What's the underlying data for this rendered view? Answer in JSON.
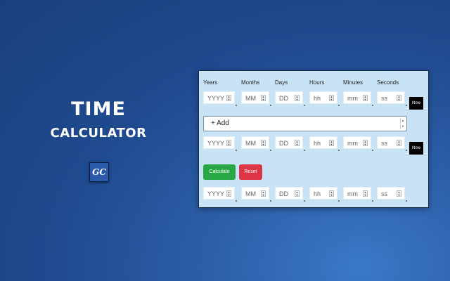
{
  "hero": {
    "title": "TIME",
    "subtitle": "CALCULATOR",
    "logo_text": "GC"
  },
  "form": {
    "headers": [
      "Years",
      "Months",
      "Days",
      "Hours",
      "Minutes",
      "Seconds"
    ],
    "placeholders": [
      "YYYY",
      "MM",
      "DD",
      "hh",
      "mm",
      "ss"
    ],
    "now_label": "Now",
    "operation_selected": "+ Add",
    "calculate_label": "Calculate",
    "reset_label": "Reset"
  },
  "colors": {
    "panel_bg": "#c9e3f6",
    "calculate": "#28a745",
    "reset": "#dc3545",
    "now": "#000000"
  }
}
